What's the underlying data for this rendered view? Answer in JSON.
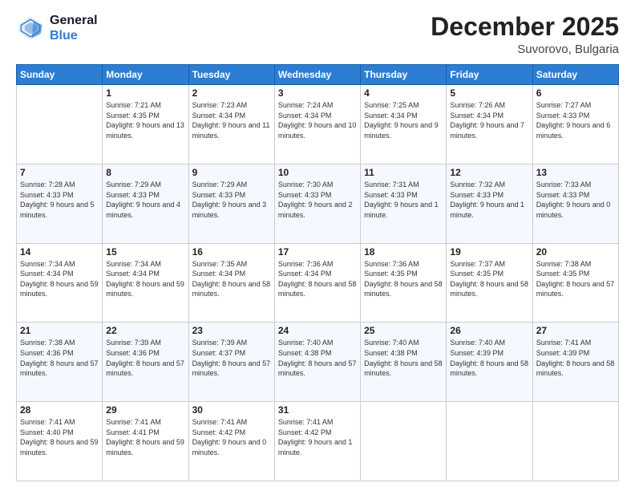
{
  "header": {
    "logo_line1": "General",
    "logo_line2": "Blue",
    "month": "December 2025",
    "location": "Suvorovo, Bulgaria"
  },
  "weekdays": [
    "Sunday",
    "Monday",
    "Tuesday",
    "Wednesday",
    "Thursday",
    "Friday",
    "Saturday"
  ],
  "weeks": [
    [
      {
        "day": "",
        "sunrise": "",
        "sunset": "",
        "daylight": ""
      },
      {
        "day": "1",
        "sunrise": "Sunrise: 7:21 AM",
        "sunset": "Sunset: 4:35 PM",
        "daylight": "Daylight: 9 hours and 13 minutes."
      },
      {
        "day": "2",
        "sunrise": "Sunrise: 7:23 AM",
        "sunset": "Sunset: 4:34 PM",
        "daylight": "Daylight: 9 hours and 11 minutes."
      },
      {
        "day": "3",
        "sunrise": "Sunrise: 7:24 AM",
        "sunset": "Sunset: 4:34 PM",
        "daylight": "Daylight: 9 hours and 10 minutes."
      },
      {
        "day": "4",
        "sunrise": "Sunrise: 7:25 AM",
        "sunset": "Sunset: 4:34 PM",
        "daylight": "Daylight: 9 hours and 9 minutes."
      },
      {
        "day": "5",
        "sunrise": "Sunrise: 7:26 AM",
        "sunset": "Sunset: 4:34 PM",
        "daylight": "Daylight: 9 hours and 7 minutes."
      },
      {
        "day": "6",
        "sunrise": "Sunrise: 7:27 AM",
        "sunset": "Sunset: 4:33 PM",
        "daylight": "Daylight: 9 hours and 6 minutes."
      }
    ],
    [
      {
        "day": "7",
        "sunrise": "Sunrise: 7:28 AM",
        "sunset": "Sunset: 4:33 PM",
        "daylight": "Daylight: 9 hours and 5 minutes."
      },
      {
        "day": "8",
        "sunrise": "Sunrise: 7:29 AM",
        "sunset": "Sunset: 4:33 PM",
        "daylight": "Daylight: 9 hours and 4 minutes."
      },
      {
        "day": "9",
        "sunrise": "Sunrise: 7:29 AM",
        "sunset": "Sunset: 4:33 PM",
        "daylight": "Daylight: 9 hours and 3 minutes."
      },
      {
        "day": "10",
        "sunrise": "Sunrise: 7:30 AM",
        "sunset": "Sunset: 4:33 PM",
        "daylight": "Daylight: 9 hours and 2 minutes."
      },
      {
        "day": "11",
        "sunrise": "Sunrise: 7:31 AM",
        "sunset": "Sunset: 4:33 PM",
        "daylight": "Daylight: 9 hours and 1 minute."
      },
      {
        "day": "12",
        "sunrise": "Sunrise: 7:32 AM",
        "sunset": "Sunset: 4:33 PM",
        "daylight": "Daylight: 9 hours and 1 minute."
      },
      {
        "day": "13",
        "sunrise": "Sunrise: 7:33 AM",
        "sunset": "Sunset: 4:33 PM",
        "daylight": "Daylight: 9 hours and 0 minutes."
      }
    ],
    [
      {
        "day": "14",
        "sunrise": "Sunrise: 7:34 AM",
        "sunset": "Sunset: 4:34 PM",
        "daylight": "Daylight: 8 hours and 59 minutes."
      },
      {
        "day": "15",
        "sunrise": "Sunrise: 7:34 AM",
        "sunset": "Sunset: 4:34 PM",
        "daylight": "Daylight: 8 hours and 59 minutes."
      },
      {
        "day": "16",
        "sunrise": "Sunrise: 7:35 AM",
        "sunset": "Sunset: 4:34 PM",
        "daylight": "Daylight: 8 hours and 58 minutes."
      },
      {
        "day": "17",
        "sunrise": "Sunrise: 7:36 AM",
        "sunset": "Sunset: 4:34 PM",
        "daylight": "Daylight: 8 hours and 58 minutes."
      },
      {
        "day": "18",
        "sunrise": "Sunrise: 7:36 AM",
        "sunset": "Sunset: 4:35 PM",
        "daylight": "Daylight: 8 hours and 58 minutes."
      },
      {
        "day": "19",
        "sunrise": "Sunrise: 7:37 AM",
        "sunset": "Sunset: 4:35 PM",
        "daylight": "Daylight: 8 hours and 58 minutes."
      },
      {
        "day": "20",
        "sunrise": "Sunrise: 7:38 AM",
        "sunset": "Sunset: 4:35 PM",
        "daylight": "Daylight: 8 hours and 57 minutes."
      }
    ],
    [
      {
        "day": "21",
        "sunrise": "Sunrise: 7:38 AM",
        "sunset": "Sunset: 4:36 PM",
        "daylight": "Daylight: 8 hours and 57 minutes."
      },
      {
        "day": "22",
        "sunrise": "Sunrise: 7:39 AM",
        "sunset": "Sunset: 4:36 PM",
        "daylight": "Daylight: 8 hours and 57 minutes."
      },
      {
        "day": "23",
        "sunrise": "Sunrise: 7:39 AM",
        "sunset": "Sunset: 4:37 PM",
        "daylight": "Daylight: 8 hours and 57 minutes."
      },
      {
        "day": "24",
        "sunrise": "Sunrise: 7:40 AM",
        "sunset": "Sunset: 4:38 PM",
        "daylight": "Daylight: 8 hours and 57 minutes."
      },
      {
        "day": "25",
        "sunrise": "Sunrise: 7:40 AM",
        "sunset": "Sunset: 4:38 PM",
        "daylight": "Daylight: 8 hours and 58 minutes."
      },
      {
        "day": "26",
        "sunrise": "Sunrise: 7:40 AM",
        "sunset": "Sunset: 4:39 PM",
        "daylight": "Daylight: 8 hours and 58 minutes."
      },
      {
        "day": "27",
        "sunrise": "Sunrise: 7:41 AM",
        "sunset": "Sunset: 4:39 PM",
        "daylight": "Daylight: 8 hours and 58 minutes."
      }
    ],
    [
      {
        "day": "28",
        "sunrise": "Sunrise: 7:41 AM",
        "sunset": "Sunset: 4:40 PM",
        "daylight": "Daylight: 8 hours and 59 minutes."
      },
      {
        "day": "29",
        "sunrise": "Sunrise: 7:41 AM",
        "sunset": "Sunset: 4:41 PM",
        "daylight": "Daylight: 8 hours and 59 minutes."
      },
      {
        "day": "30",
        "sunrise": "Sunrise: 7:41 AM",
        "sunset": "Sunset: 4:42 PM",
        "daylight": "Daylight: 9 hours and 0 minutes."
      },
      {
        "day": "31",
        "sunrise": "Sunrise: 7:41 AM",
        "sunset": "Sunset: 4:42 PM",
        "daylight": "Daylight: 9 hours and 1 minute."
      },
      {
        "day": "",
        "sunrise": "",
        "sunset": "",
        "daylight": ""
      },
      {
        "day": "",
        "sunrise": "",
        "sunset": "",
        "daylight": ""
      },
      {
        "day": "",
        "sunrise": "",
        "sunset": "",
        "daylight": ""
      }
    ]
  ]
}
